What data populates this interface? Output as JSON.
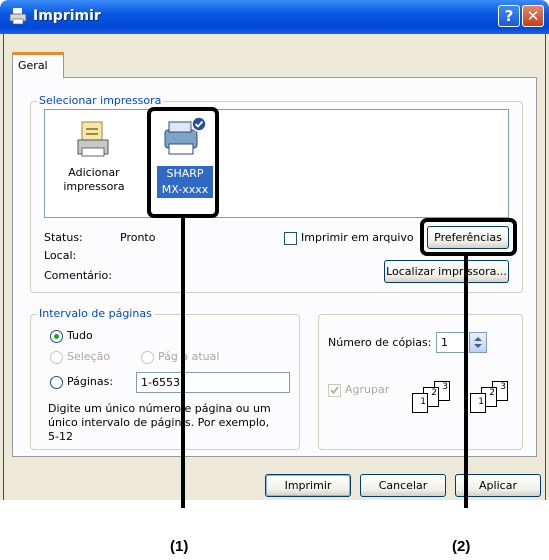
{
  "window": {
    "title": "Imprimir",
    "help_glyph": "?",
    "close_glyph": "✕"
  },
  "tabs": [
    {
      "label": "Geral"
    }
  ],
  "select_printer": {
    "legend": "Selecionar impressora",
    "printers": [
      {
        "label_line1": "Adicionar",
        "label_line2": "impressora",
        "selected": false,
        "icon": "add-printer-icon"
      },
      {
        "label_line1": "SHARP",
        "label_line2": "MX-xxxx",
        "selected": true,
        "icon": "printer-icon"
      }
    ],
    "status_label": "Status:",
    "status_value": "Pronto",
    "local_label": "Local:",
    "comment_label": "Comentário:",
    "print_to_file_label": "Imprimir em arquivo",
    "preferences_button": "Preferências",
    "find_printer_button": "Localizar impr    ssora..."
  },
  "page_range": {
    "legend": "Intervalo de páginas",
    "all_label": "Tudo",
    "selection_label": "Seleção",
    "current_page_label": "Pág   a atual",
    "pages_label": "Páginas:",
    "pages_value": "1-6553",
    "help_line1": "Digite um único número   e página ou um",
    "help_line2": "único intervalo de págin  s. Por exemplo,",
    "help_line3": "5-12"
  },
  "copies": {
    "copies_label": "Número de cópias:",
    "copies_value": "1",
    "collate_label": "Agrupar",
    "page_numbers": [
      "1",
      "2",
      "3"
    ]
  },
  "footer": {
    "print_button": "Imprimir",
    "cancel_button": "Cancelar",
    "apply_button": "Aplicar"
  },
  "callouts": [
    {
      "label": "(1)"
    },
    {
      "label": "(2)"
    }
  ]
}
